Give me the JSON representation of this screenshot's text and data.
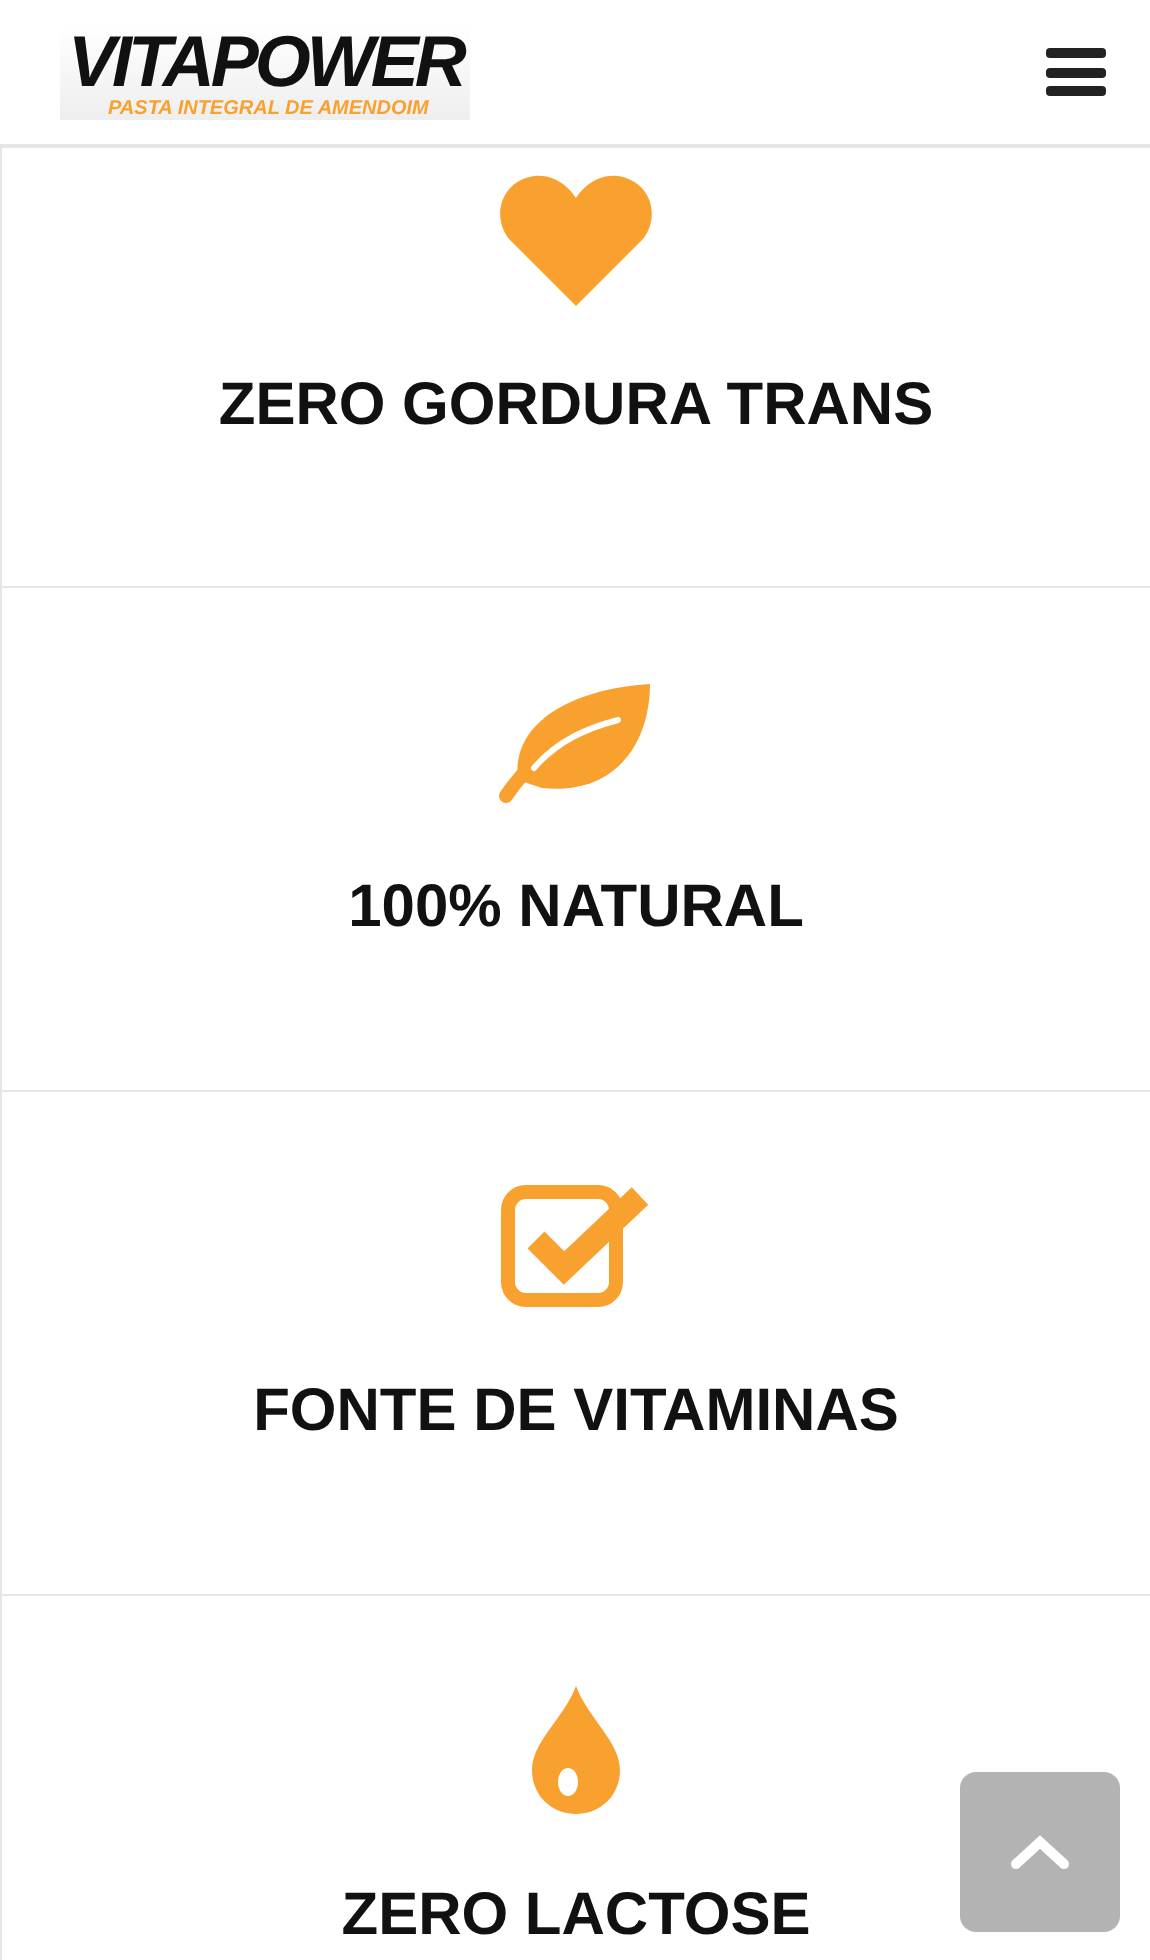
{
  "header": {
    "logo": {
      "name": "VITAPOWER",
      "tagline": "PASTA INTEGRAL DE AMENDOIM"
    }
  },
  "features": [
    {
      "kind": "heart",
      "title": "ZERO GORDURA TRANS"
    },
    {
      "kind": "leaf",
      "title": "100% NATURAL"
    },
    {
      "kind": "check",
      "title": "FONTE DE VITAMINAS"
    },
    {
      "kind": "drop",
      "title": "ZERO LACTOSE"
    }
  ]
}
